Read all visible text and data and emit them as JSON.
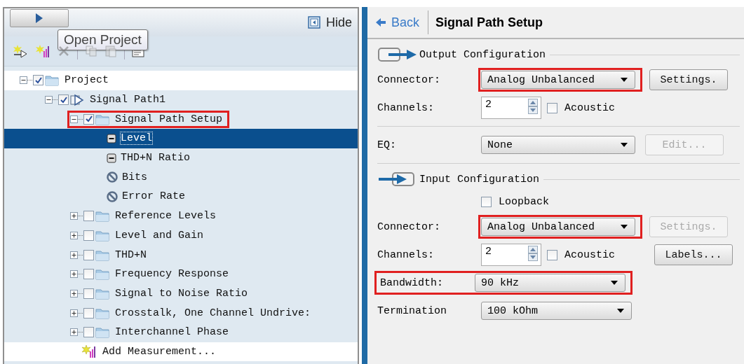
{
  "left_panel": {
    "tooltip": "Open Project",
    "hide_button": "Hide",
    "toolbar": [
      {
        "kind": "add-path",
        "disabled": false
      },
      {
        "kind": "add-measurement",
        "disabled": false
      },
      {
        "kind": "delete",
        "disabled": true
      },
      {
        "kind": "separator"
      },
      {
        "kind": "copy",
        "disabled": true
      },
      {
        "kind": "paste",
        "disabled": true
      },
      {
        "kind": "separator"
      },
      {
        "kind": "properties",
        "disabled": false
      }
    ],
    "tree": [
      {
        "label": "Project",
        "kind": "folder",
        "expanded": true,
        "checked": true,
        "selected": false,
        "highlighted": false,
        "children": [
          {
            "label": "Signal Path1",
            "kind": "signal-path",
            "expanded": true,
            "checked": true,
            "selected": false,
            "highlighted": false,
            "children": [
              {
                "label": "Signal Path Setup",
                "kind": "folder",
                "expanded": true,
                "checked": true,
                "selected": false,
                "highlighted": true,
                "children": [
                  {
                    "label": "Level",
                    "kind": "meter",
                    "selected": true,
                    "highlighted": false
                  },
                  {
                    "label": "THD+N Ratio",
                    "kind": "meter",
                    "selected": false,
                    "highlighted": false
                  },
                  {
                    "label": "Bits",
                    "kind": "blocked",
                    "selected": false,
                    "highlighted": false
                  },
                  {
                    "label": "Error Rate",
                    "kind": "blocked",
                    "selected": false,
                    "highlighted": false
                  }
                ]
              },
              {
                "label": "Reference Levels",
                "kind": "folder",
                "expanded": false,
                "checked": false,
                "selected": false,
                "highlighted": false
              },
              {
                "label": "Level and Gain",
                "kind": "folder",
                "expanded": false,
                "checked": false,
                "selected": false,
                "highlighted": false
              },
              {
                "label": "THD+N",
                "kind": "folder",
                "expanded": false,
                "checked": false,
                "selected": false,
                "highlighted": false
              },
              {
                "label": "Frequency Response",
                "kind": "folder",
                "expanded": false,
                "checked": false,
                "selected": false,
                "highlighted": false
              },
              {
                "label": "Signal to Noise Ratio",
                "kind": "folder",
                "expanded": false,
                "checked": false,
                "selected": false,
                "highlighted": false
              },
              {
                "label": "Crosstalk, One Channel Undrive:",
                "kind": "folder",
                "expanded": false,
                "checked": false,
                "selected": false,
                "highlighted": false
              },
              {
                "label": "Interchannel Phase",
                "kind": "folder",
                "expanded": false,
                "checked": false,
                "selected": false,
                "highlighted": false
              },
              {
                "label": "Add Measurement...",
                "kind": "add",
                "selected": false,
                "highlighted": false
              }
            ]
          }
        ]
      }
    ]
  },
  "right_panel": {
    "back": "Back",
    "title": "Signal Path Setup",
    "output": {
      "title": "Output Configuration",
      "connector": {
        "label": "Connector:",
        "value": "Analog Unbalanced",
        "highlighted": true
      },
      "settings": {
        "label": "Settings.",
        "disabled": false
      },
      "channels": {
        "label": "Channels:",
        "value": "2"
      },
      "acoustic": {
        "label": "Acoustic",
        "checked": false
      }
    },
    "eq": {
      "label": "EQ:",
      "value": "None",
      "edit": {
        "label": "Edit...",
        "disabled": true
      }
    },
    "input": {
      "title": "Input Configuration",
      "loopback": {
        "label": "Loopback",
        "checked": false
      },
      "connector": {
        "label": "Connector:",
        "value": "Analog Unbalanced",
        "highlighted": true
      },
      "settings": {
        "label": "Settings.",
        "disabled": true
      },
      "channels": {
        "label": "Channels:",
        "value": "2"
      },
      "acoustic": {
        "label": "Acoustic",
        "checked": false
      },
      "labels": {
        "label": "Labels...",
        "disabled": false
      },
      "bandwidth": {
        "label": "Bandwidth:",
        "value": "90 kHz",
        "highlighted": true
      },
      "termination": {
        "label": "Termination",
        "value": "100 kOhm"
      }
    }
  }
}
